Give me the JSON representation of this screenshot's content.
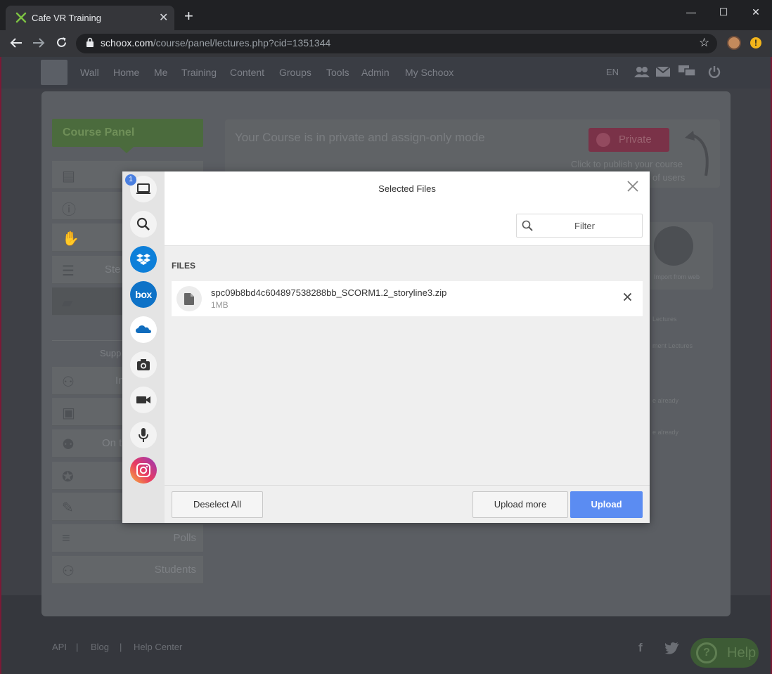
{
  "browser": {
    "tab_title": "Cafe VR Training",
    "tab_close": "✕",
    "new_tab": "+",
    "url_host": "schoox.com",
    "url_path": "/course/panel/lectures.php?cid=1351344",
    "window_minimize": "—",
    "window_maximize": "☐",
    "window_close": "✕"
  },
  "site_nav": {
    "items": [
      "Wall",
      "Home",
      "Me",
      "Training",
      "Content",
      "Groups",
      "Tools",
      "Admin",
      "My Schoox"
    ],
    "language": "EN"
  },
  "course_panel": {
    "title": "Course Panel",
    "sidebar_labels": [
      "Ste",
      "In",
      "On t",
      "Polls",
      "Students"
    ],
    "support_label": "Supp",
    "status_text": "Your Course is in private and assign-only mode",
    "private_label": "Private",
    "publish_text_line1": "Click to publish your course",
    "publish_text_line2": "of users",
    "import_web": "Import from web",
    "faded_1": "Lectures",
    "faded_2": "ment Lectures",
    "faded_3": "e already",
    "faded_4": "e already"
  },
  "footer": {
    "links": [
      "API",
      "Blog",
      "Help Center"
    ],
    "sep": "|",
    "help_label": "Help",
    "facebook": "f"
  },
  "picker": {
    "badge_count": "1",
    "box_label": "box",
    "title": "Selected Files",
    "close": "✕",
    "filter_placeholder": "Filter",
    "files_heading": "FILES",
    "file": {
      "name": "spc09b8bd4c604897538288bb_SCORM1.2_storyline3.zip",
      "size": "1MB",
      "remove": "✕"
    },
    "deselect_label": "Deselect All",
    "upload_more_label": "Upload more",
    "upload_label": "Upload"
  },
  "colors": {
    "upload_accent": "#5b8cf2",
    "course_panel_green": "#4b6b3d",
    "private_red": "#7a3248"
  }
}
